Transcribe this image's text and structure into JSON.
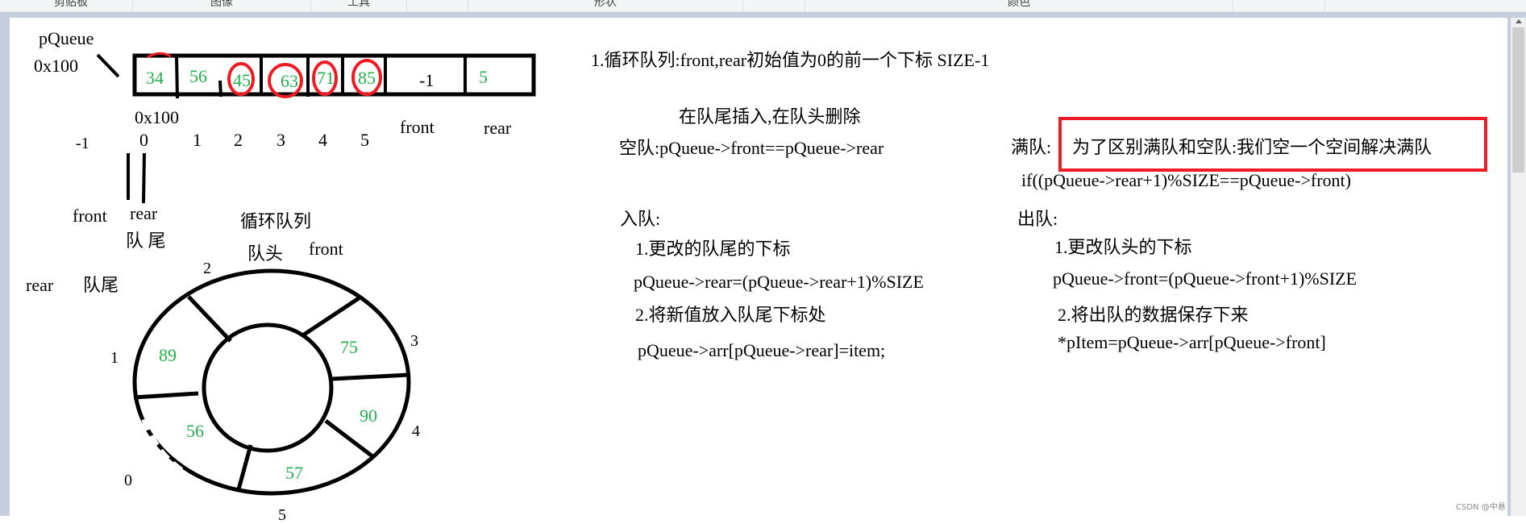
{
  "toolbar": {
    "groups": [
      "剪贴板",
      "图像",
      "工具",
      "",
      "形状",
      "",
      "颜色",
      "",
      ""
    ]
  },
  "diagram": {
    "pointer_label": "pQueue",
    "pointer_value": "0x100",
    "array_cells": [
      {
        "value": "34",
        "circled": false
      },
      {
        "value": "56",
        "circled": false
      },
      {
        "value": "45",
        "circled": true
      },
      {
        "value": "63",
        "circled": true
      },
      {
        "value": "71",
        "circled": true
      },
      {
        "value": "85",
        "circled": true
      },
      {
        "value": "-1",
        "circled": false
      },
      {
        "value": "5",
        "circled": false
      }
    ],
    "array_address": "0x100",
    "indices": [
      "-1",
      "0",
      "1",
      "2",
      "3",
      "4",
      "5"
    ],
    "field_labels": {
      "front": "front",
      "rear": "rear"
    },
    "under_labels": {
      "front": "front",
      "rear": "rear",
      "tail": "队 尾"
    },
    "ring": {
      "title": "循环队列",
      "head_label": "队头",
      "front_label": "front",
      "rear_label": "rear",
      "tail_label": "队尾",
      "slots": [
        {
          "index": "0",
          "value": "56"
        },
        {
          "index": "1",
          "value": "89"
        },
        {
          "index": "2",
          "value": ""
        },
        {
          "index": "3",
          "value": "75"
        },
        {
          "index": "4",
          "value": "90"
        },
        {
          "index": "5",
          "value": "57"
        }
      ]
    }
  },
  "notes": {
    "heading": "1.循环队列:front,rear初始值为0的前一个下标   SIZE-1",
    "insert_delete": "在队尾插入,在队头删除",
    "empty_queue": "空队:pQueue->front==pQueue->rear",
    "full_queue_label": "满队:",
    "full_queue_note": "为了区别满队和空队:我们空一个空间解决满队",
    "full_queue_condition": "if((pQueue->rear+1)%SIZE==pQueue->front)",
    "enqueue": {
      "title": "入队:",
      "step1": "1.更改的队尾的下标",
      "code1": "pQueue->rear=(pQueue->rear+1)%SIZE",
      "step2": "2.将新值放入队尾下标处",
      "code2": "pQueue->arr[pQueue->rear]=item;"
    },
    "dequeue": {
      "title": "出队:",
      "step1": "1.更改队头的下标",
      "code1": "pQueue->front=(pQueue->front+1)%SIZE",
      "step2": "2.将出队的数据保存下来",
      "code2": "*pItem=pQueue->arr[pQueue->front]"
    }
  },
  "colors": {
    "value_green": "#22b14c",
    "highlight_red": "#ed1c24",
    "ink": "#000000"
  },
  "watermark": "CSDN @中悬"
}
